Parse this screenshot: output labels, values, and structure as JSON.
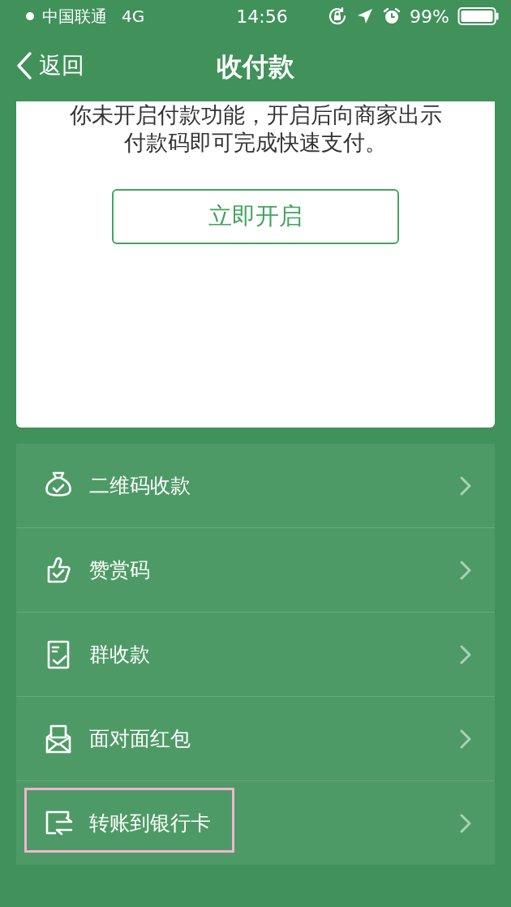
{
  "status_bar": {
    "carrier": "中国联通",
    "network": "4G",
    "time": "14:56",
    "battery": "99%"
  },
  "nav": {
    "back": "返回",
    "title": "收付款"
  },
  "card": {
    "lines": [
      "你未开启付款功能，开启后向商家出示",
      "付款码即可完成快速支付。"
    ],
    "button": "立即开启"
  },
  "items": [
    {
      "kind": "bag",
      "label": "二维码收款",
      "highlighted": false
    },
    {
      "kind": "thumb",
      "label": "赞赏码",
      "highlighted": false
    },
    {
      "kind": "note",
      "label": "群收款",
      "highlighted": false
    },
    {
      "kind": "envelope",
      "label": "面对面红包",
      "highlighted": false
    },
    {
      "kind": "transfer",
      "label": "转账到银行卡",
      "highlighted": true
    }
  ]
}
